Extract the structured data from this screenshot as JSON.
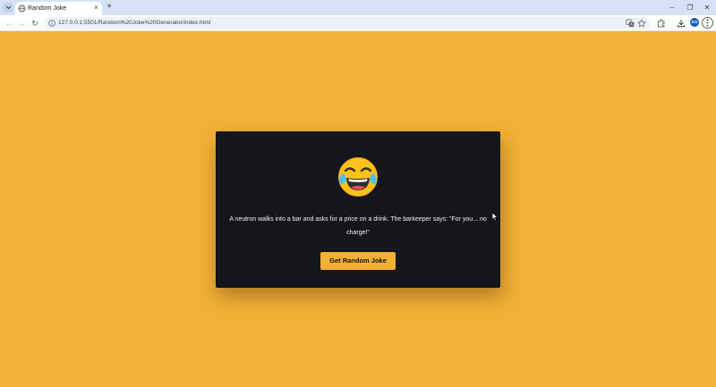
{
  "browser": {
    "tab": {
      "title": "Random Joke",
      "close_icon": "×"
    },
    "new_tab_icon": "+",
    "url": "127.0.0.1:5501/Random%20Joke%20Generator/index.html",
    "profile_initials": "KS",
    "window_controls": {
      "minimize": "–",
      "restore": "❐",
      "close": "✕"
    },
    "nav": {
      "back": "←",
      "forward": "→",
      "reload": "↻"
    }
  },
  "page": {
    "joke": "A neutron walks into a bar and asks for a price on a drink. The barkeeper says: \"For you... no charge!\"",
    "button_label": "Get Random Joke",
    "emoji_icon": "face-with-tears-of-joy-icon"
  },
  "colors": {
    "background": "#f2b135",
    "card": "#14161b",
    "button": "#f2b135",
    "joke_text": "#f2f2f2"
  }
}
